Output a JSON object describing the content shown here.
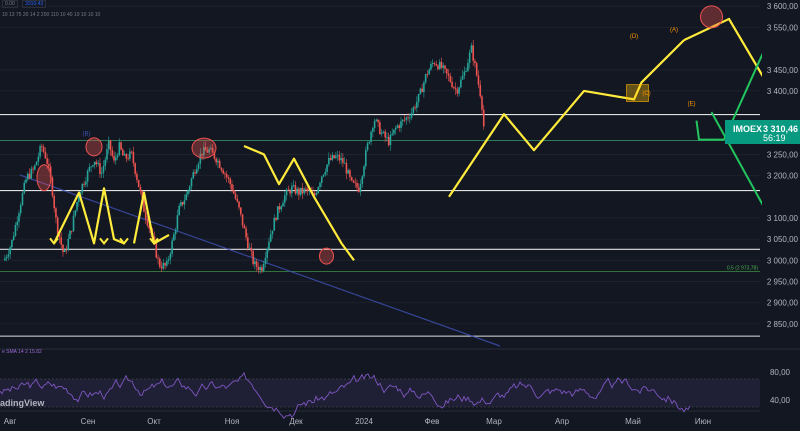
{
  "header": {
    "price_box": "0.00",
    "price_value": "3310.43",
    "params": "10 13 75 20 14 2 200 110 10 40 10 10 10 10"
  },
  "brand": {
    "logo_text": "adingView"
  },
  "ticker": {
    "symbol": "IMOEX",
    "price": "3 310,46",
    "countdown": "56:19"
  },
  "rsi": {
    "label": "e SMA 14 2",
    "value": "15.82"
  },
  "colors": {
    "background": "#131722",
    "up": "#26a69a",
    "down": "#ef5350",
    "wave": "#ffeb3b",
    "forecast": "#22c55e",
    "trendline": "#3f51b5",
    "rsi": "#7e57c2",
    "hline": "#e0e0e0"
  },
  "chart_data": {
    "type": "candlestick",
    "x_categories": [
      "Авг",
      "Сен",
      "Окт",
      "Ноя",
      "Дек",
      "2024",
      "Фев",
      "Мар",
      "Апр",
      "Май",
      "Июн"
    ],
    "y_ticks": [
      "3 600,00",
      "3 550,00",
      "3 450,00",
      "3 400,00",
      "3 250,00",
      "3 200,00",
      "3 100,00",
      "3 050,00",
      "3 000,00",
      "2 950,00",
      "2 900,00",
      "2 850,00"
    ],
    "ylim": [
      2800,
      3610
    ],
    "horizontal_levels": [
      {
        "label": "3 344,10",
        "value": 3344.1
      },
      {
        "label": "3 164,81",
        "value": 3164.81
      },
      {
        "label": "3 025,89",
        "value": 3025.89
      },
      {
        "label": "2 820,94",
        "value": 2820.94
      }
    ],
    "fib_level": {
      "label": "0.5 (2 973,78)",
      "value": 2973.78
    },
    "green_level": {
      "value": 3283
    },
    "price_path": [
      [
        0,
        3000
      ],
      [
        3,
        3040
      ],
      [
        6,
        3120
      ],
      [
        9,
        3195
      ],
      [
        12,
        3215
      ],
      [
        15,
        3270
      ],
      [
        17,
        3240
      ],
      [
        19,
        3180
      ],
      [
        21,
        3085
      ],
      [
        24,
        3010
      ],
      [
        27,
        3075
      ],
      [
        30,
        3160
      ],
      [
        33,
        3200
      ],
      [
        36,
        3240
      ],
      [
        39,
        3205
      ],
      [
        42,
        3275
      ],
      [
        44,
        3230
      ],
      [
        46,
        3270
      ],
      [
        48,
        3240
      ],
      [
        51,
        3250
      ],
      [
        53,
        3200
      ],
      [
        56,
        3120
      ],
      [
        59,
        3060
      ],
      [
        62,
        2990
      ],
      [
        65,
        2985
      ],
      [
        68,
        3060
      ],
      [
        70,
        3120
      ],
      [
        73,
        3155
      ],
      [
        76,
        3210
      ],
      [
        79,
        3255
      ],
      [
        82,
        3260
      ],
      [
        85,
        3240
      ],
      [
        88,
        3210
      ],
      [
        91,
        3175
      ],
      [
        94,
        3120
      ],
      [
        97,
        3050
      ],
      [
        100,
        2990
      ],
      [
        103,
        2980
      ],
      [
        106,
        3050
      ],
      [
        109,
        3110
      ],
      [
        112,
        3150
      ],
      [
        115,
        3170
      ],
      [
        118,
        3160
      ],
      [
        121,
        3165
      ],
      [
        124,
        3150
      ],
      [
        127,
        3200
      ],
      [
        130,
        3235
      ],
      [
        133,
        3245
      ],
      [
        136,
        3230
      ],
      [
        139,
        3180
      ],
      [
        142,
        3170
      ],
      [
        145,
        3260
      ],
      [
        148,
        3335
      ],
      [
        151,
        3300
      ],
      [
        154,
        3280
      ],
      [
        157,
        3315
      ],
      [
        160,
        3330
      ],
      [
        163,
        3350
      ],
      [
        166,
        3385
      ],
      [
        169,
        3440
      ],
      [
        172,
        3470
      ],
      [
        175,
        3455
      ],
      [
        178,
        3430
      ],
      [
        181,
        3400
      ],
      [
        184,
        3440
      ],
      [
        187,
        3500
      ],
      [
        189,
        3440
      ],
      [
        191,
        3380
      ],
      [
        192,
        3310
      ]
    ],
    "price_path_xmax": 192,
    "waves": [
      {
        "name": "wave-a",
        "points": [
          [
            20,
            3040
          ],
          [
            30,
            3160
          ],
          [
            36,
            3040
          ],
          [
            40,
            3170
          ],
          [
            44,
            3050
          ],
          [
            48,
            3040
          ]
        ]
      },
      {
        "name": "wave-b",
        "points": [
          [
            52,
            3040
          ],
          [
            56,
            3160
          ],
          [
            60,
            3040
          ],
          [
            66,
            3060
          ]
        ]
      },
      {
        "name": "wave-c",
        "points": [
          [
            96,
            3270
          ],
          [
            104,
            3250
          ],
          [
            110,
            3180
          ],
          [
            116,
            3240
          ],
          [
            124,
            3150
          ],
          [
            135,
            3040
          ],
          [
            140,
            3000
          ]
        ]
      },
      {
        "name": "wave-d",
        "points": [
          [
            178,
            3150
          ],
          [
            200,
            3345
          ],
          [
            212,
            3260
          ],
          [
            232,
            3400
          ],
          [
            252,
            3380
          ],
          [
            255,
            3420
          ],
          [
            272,
            3520
          ]
        ]
      },
      {
        "name": "wave-e",
        "points": [
          [
            272,
            3520
          ],
          [
            290,
            3570
          ],
          [
            306,
            3410
          ]
        ]
      }
    ],
    "forecast": [
      {
        "name": "forecast-up",
        "points": [
          [
            288,
            3285
          ],
          [
            312,
            3600
          ]
        ]
      },
      {
        "name": "forecast-down",
        "points": [
          [
            283,
            3350
          ],
          [
            312,
            3040
          ]
        ]
      }
    ],
    "wave_labels": [
      "(B)",
      "(D)",
      "(C)",
      "(E)",
      "(A)"
    ],
    "rsi_ticks": [
      "80,00",
      "40,00"
    ],
    "rsi_range": [
      0,
      100
    ],
    "rsi_band": [
      30,
      70
    ]
  }
}
